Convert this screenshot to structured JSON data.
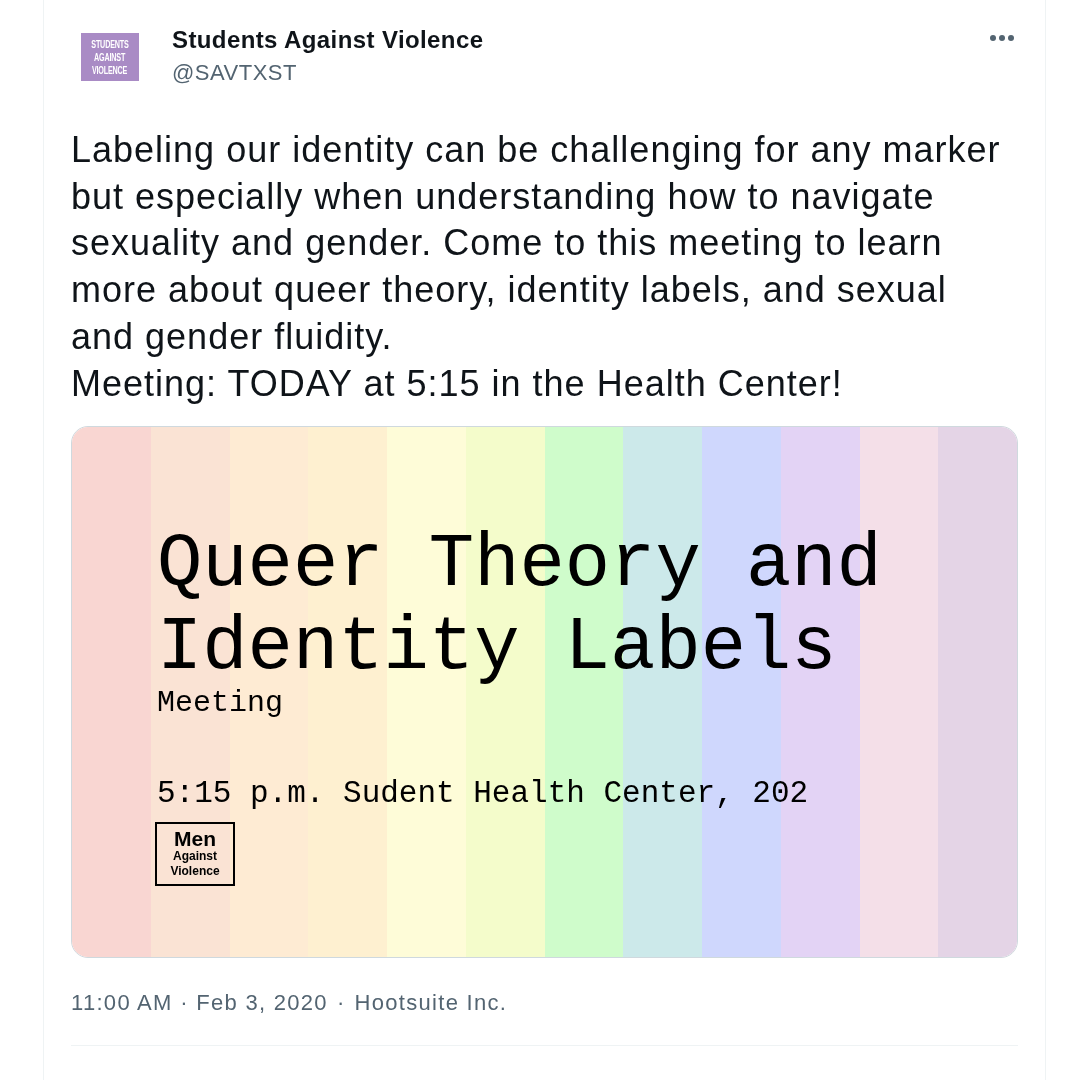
{
  "account": {
    "avatar_text": [
      "STUDENTS",
      "AGAINST",
      "VIOLENCE"
    ],
    "name": "Students Against Violence",
    "handle": "@SAVTXST"
  },
  "tweet": {
    "paragraphs": [
      "Labeling our identity can be challenging for any marker but especially when understanding how to navigate sexuality and gender. Come to this meeting to learn more about queer theory, identity labels, and sexual and gender fluidity.",
      "Meeting: TODAY at 5:15 in the Health Center!"
    ]
  },
  "image": {
    "title": "Queer Theory and Identity Labels",
    "subtitle": "Meeting",
    "details": "5:15 p.m. Sudent Health Center, 202",
    "logo_text": [
      "Men",
      "Against",
      "Violence"
    ]
  },
  "meta": {
    "timestamp": "11:00 AM · Feb 3, 2020",
    "separator": "·",
    "source": "Hootsuite Inc."
  }
}
